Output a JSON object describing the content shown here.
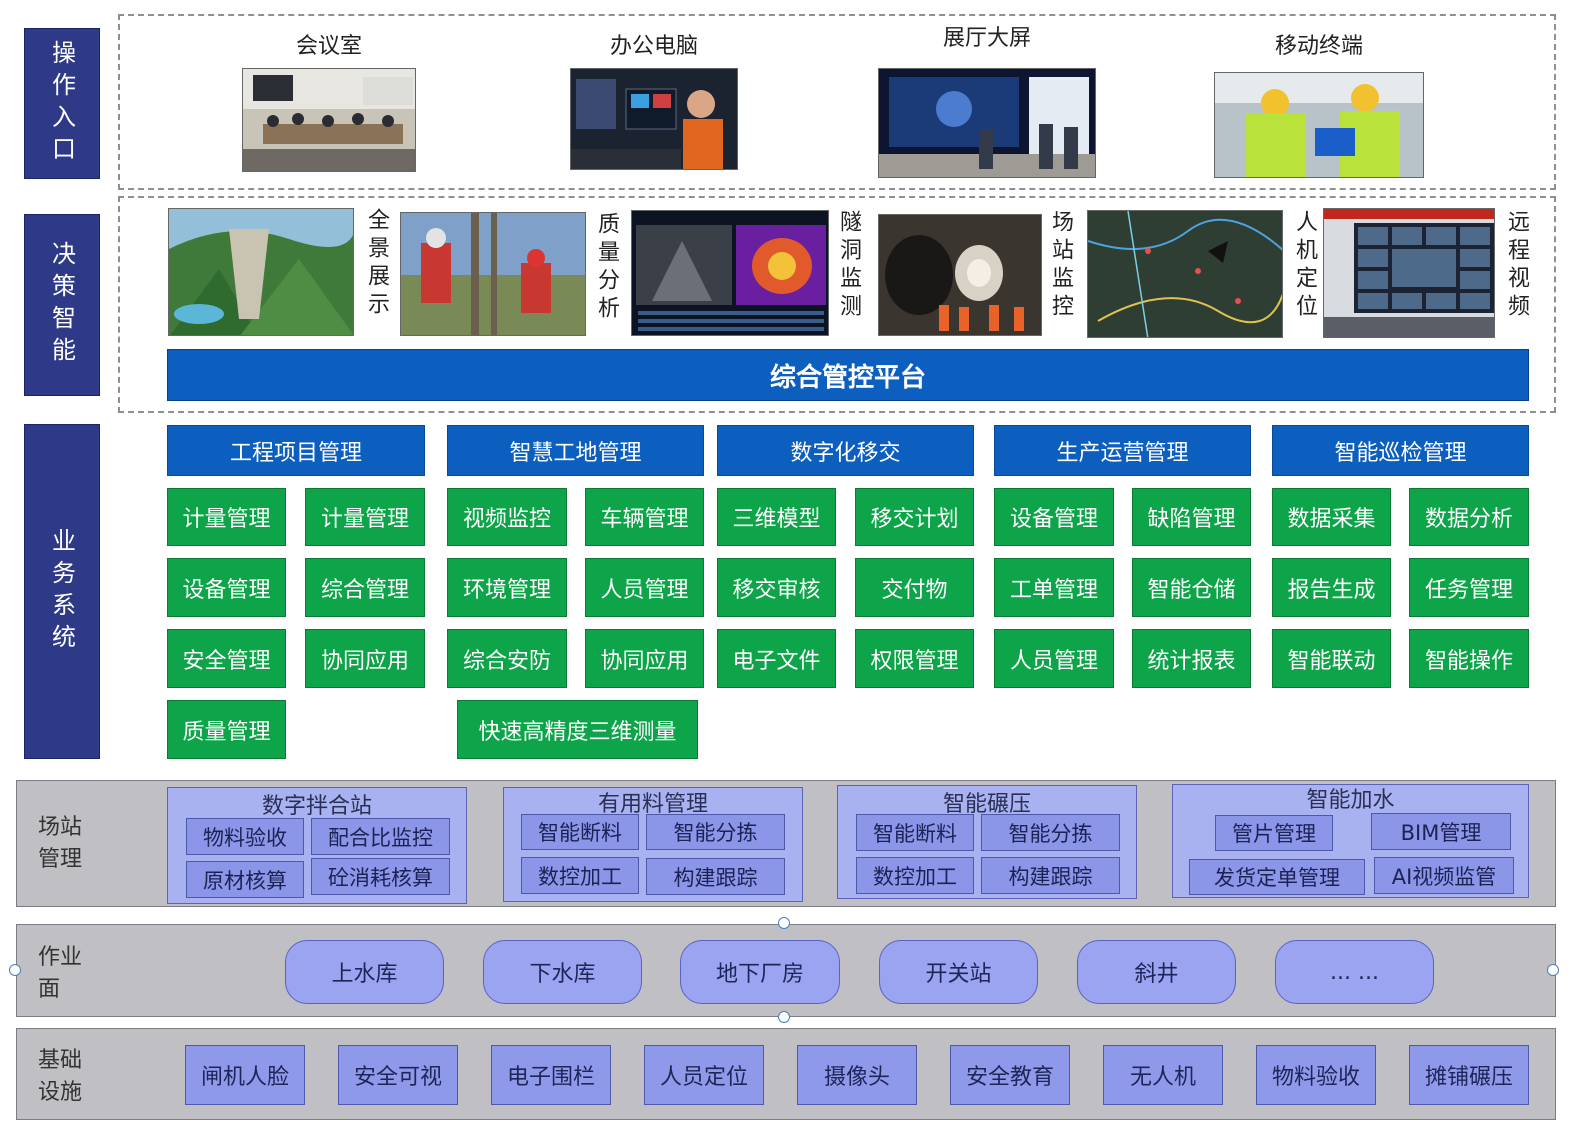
{
  "side_labels": [
    "操作入口",
    "决策智能",
    "业务系统"
  ],
  "entry": {
    "items": [
      {
        "label": "会议室",
        "photo": "meeting-room-photo"
      },
      {
        "label": "办公电脑",
        "photo": "office-computer-photo"
      },
      {
        "label": "展厅大屏",
        "photo": "exhibition-screen-photo"
      },
      {
        "label": "移动终端",
        "photo": "mobile-terminal-photo"
      }
    ]
  },
  "decision": {
    "items": [
      {
        "label": "全景展示",
        "photo": "panorama-photo"
      },
      {
        "label": "质量分析",
        "photo": "quality-analysis-photo"
      },
      {
        "label": "隧洞监测",
        "photo": "tunnel-monitor-photo"
      },
      {
        "label": "场站监控",
        "photo": "station-monitor-photo"
      },
      {
        "label": "人机定位",
        "photo": "positioning-map-photo"
      },
      {
        "label": "远程视频",
        "photo": "remote-video-photo"
      }
    ],
    "platform": "综合管控平台"
  },
  "business": {
    "headers": [
      "工程项目管理",
      "智慧工地管理",
      "数字化移交",
      "生产运营管理",
      "智能巡检管理"
    ],
    "col1": [
      "计量管理",
      "计量管理",
      "设备管理",
      "综合管理",
      "安全管理",
      "协同应用",
      "质量管理"
    ],
    "col2": [
      "视频监控",
      "车辆管理",
      "环境管理",
      "人员管理",
      "综合安防",
      "协同应用",
      "快速高精度三维测量"
    ],
    "col3": [
      "三维模型",
      "移交计划",
      "移交审核",
      "交付物",
      "电子文件",
      "权限管理"
    ],
    "col4": [
      "设备管理",
      "缺陷管理",
      "工单管理",
      "智能仓储",
      "人员管理",
      "统计报表"
    ],
    "col5": [
      "数据采集",
      "数据分析",
      "报告生成",
      "任务管理",
      "智能联动",
      "智能操作"
    ]
  },
  "station": {
    "label": "场站\n管理",
    "groups": [
      {
        "title": "数字拌合站",
        "items": [
          "物料验收",
          "配合比监控",
          "原材核算",
          "砼消耗核算"
        ]
      },
      {
        "title": "有用料管理",
        "items": [
          "智能断料",
          "智能分拣",
          "数控加工",
          "构建跟踪"
        ]
      },
      {
        "title": "智能碾压",
        "items": [
          "智能断料",
          "智能分拣",
          "数控加工",
          "构建跟踪"
        ]
      },
      {
        "title": "智能加水",
        "items": [
          "管片管理",
          "BIM管理",
          "发货定单管理",
          "AI视频监管"
        ]
      }
    ]
  },
  "work": {
    "label": "作业\n面",
    "items": [
      "上水库",
      "下水库",
      "地下厂房",
      "开关站",
      "斜井",
      "... ..."
    ]
  },
  "infra": {
    "label": "基础\n设施",
    "items": [
      "闸机人脸",
      "安全可视",
      "电子围栏",
      "人员定位",
      "摄像头",
      "安全教育",
      "无人机",
      "物料验收",
      "摊铺碾压"
    ]
  }
}
